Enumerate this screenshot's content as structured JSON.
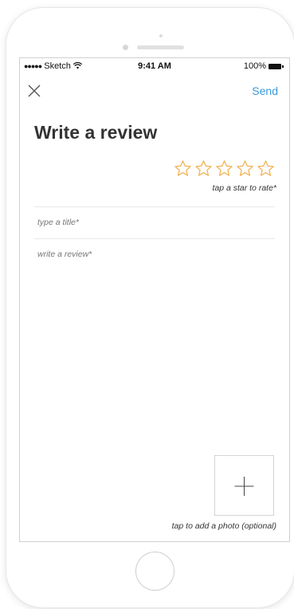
{
  "status_bar": {
    "carrier_dots": "●●●●●",
    "carrier": "Sketch",
    "wifi_icon": "wifi-icon",
    "time": "9:41 AM",
    "battery_percent": "100%"
  },
  "nav": {
    "close_icon": "close-icon",
    "send_label": "Send"
  },
  "page": {
    "title": "Write a review"
  },
  "rating": {
    "star_count": 5,
    "selected": 0,
    "hint": "tap a star to rate*"
  },
  "form": {
    "title_placeholder": "type a title*",
    "review_placeholder": "write a review*"
  },
  "photo": {
    "icon": "plus-icon",
    "hint": "tap to add a photo (optional)"
  },
  "colors": {
    "accent": "#3b98d9",
    "star_outline": "#f2b04f"
  }
}
